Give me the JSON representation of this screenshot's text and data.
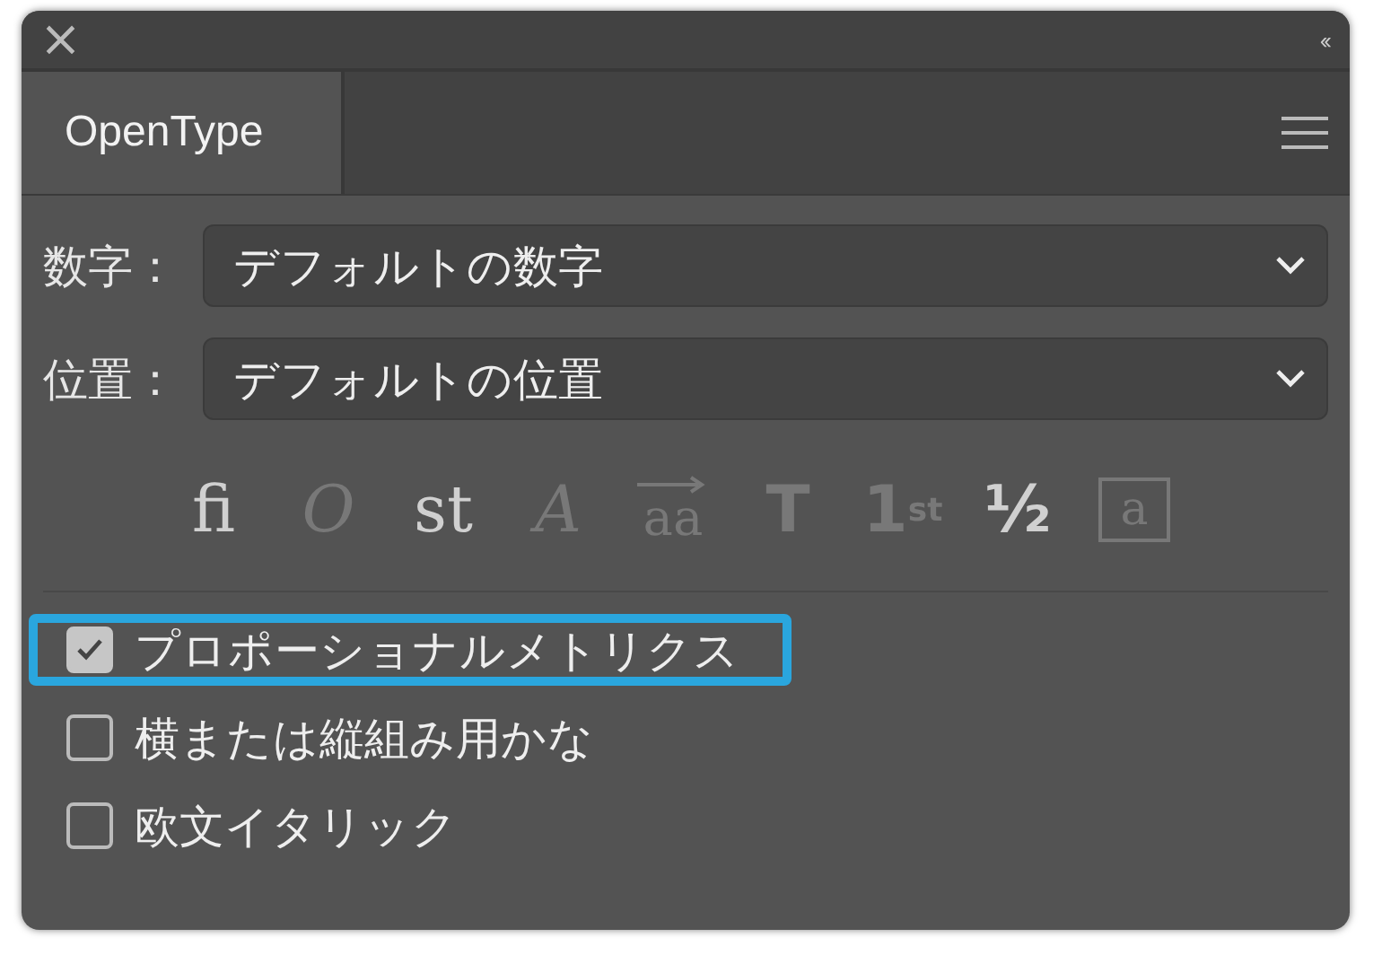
{
  "panel": {
    "close": "×",
    "collapse": "‹‹"
  },
  "tabs": [
    {
      "label": "OpenType",
      "selected": true
    }
  ],
  "fields": [
    {
      "label": "数字：",
      "value": "デフォルトの数字"
    },
    {
      "label": "位置：",
      "value": "デフォルトの位置"
    }
  ],
  "glyph_buttons": [
    {
      "glyph": "ﬁ",
      "disabled": false,
      "kind": "plain"
    },
    {
      "glyph": "O",
      "disabled": true,
      "kind": "italic"
    },
    {
      "glyph": "st",
      "disabled": false,
      "kind": "plain"
    },
    {
      "glyph": "A",
      "disabled": true,
      "kind": "italic"
    },
    {
      "glyph": "aa",
      "disabled": true,
      "kind": "arrow"
    },
    {
      "glyph": "T",
      "disabled": true,
      "kind": "bold"
    },
    {
      "glyph": "1$^{st}$",
      "disabled": true,
      "kind": "bold"
    },
    {
      "glyph": "½",
      "disabled": false,
      "kind": "bold"
    },
    {
      "glyph": "a",
      "disabled": true,
      "kind": "framed"
    }
  ],
  "checkboxes": [
    {
      "label": "プロポーショナルメトリクス",
      "checked": true,
      "highlighted": true
    },
    {
      "label": "横または縦組み用かな",
      "checked": false,
      "highlighted": false
    },
    {
      "label": "欧文イタリック",
      "checked": false,
      "highlighted": false
    }
  ]
}
